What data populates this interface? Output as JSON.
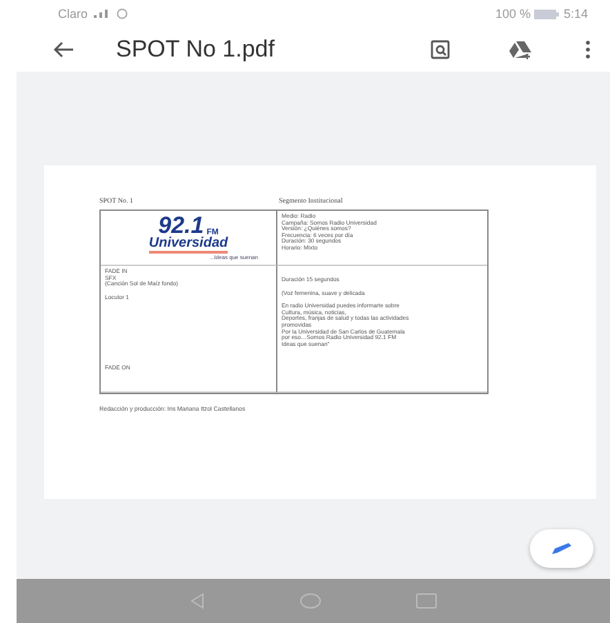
{
  "status_bar": {
    "carrier": "Claro",
    "battery": "100 %",
    "time": "5:14"
  },
  "toolbar": {
    "title": "SPOT No 1.pdf"
  },
  "document": {
    "heading_left": "SPOT No. 1",
    "heading_right": "Segmento Institucional",
    "logo": {
      "number": "92.1",
      "band": "FM",
      "name": "Universidad",
      "slogan": "...Ideas que suenan"
    },
    "info_lines": [
      "Medio: Radio",
      "Campaña: Somos Radio Universidad",
      "Versión: ¿Quiénes somos?",
      "Frecuencia: 6 veces por día",
      "Duración: 30 segundos",
      "Horario: Mixto"
    ],
    "cues_top": [
      "FADE IN",
      "SFX",
      "(Canción Sol de Maíz fondo)"
    ],
    "speaker": "Locutor 1",
    "cue_end": "FADE ON",
    "duration": "Duración 15 segundos",
    "voice": "(Voz femenina, suave y delicada",
    "script_lines": [
      "En radio Universidad puedes informarte sobre",
      "Cultura, música, noticias,",
      "Deportes, franjas de salud y todas las actividades",
      "promovidas",
      "Por la Universidad de San Carlos de Guatemala",
      "por eso…Somos Radio Universidad 92.1 FM",
      "Ideas que suenan\""
    ],
    "credits": "Redacción y producción:  Iris Mariana Itzol Castellanos"
  }
}
